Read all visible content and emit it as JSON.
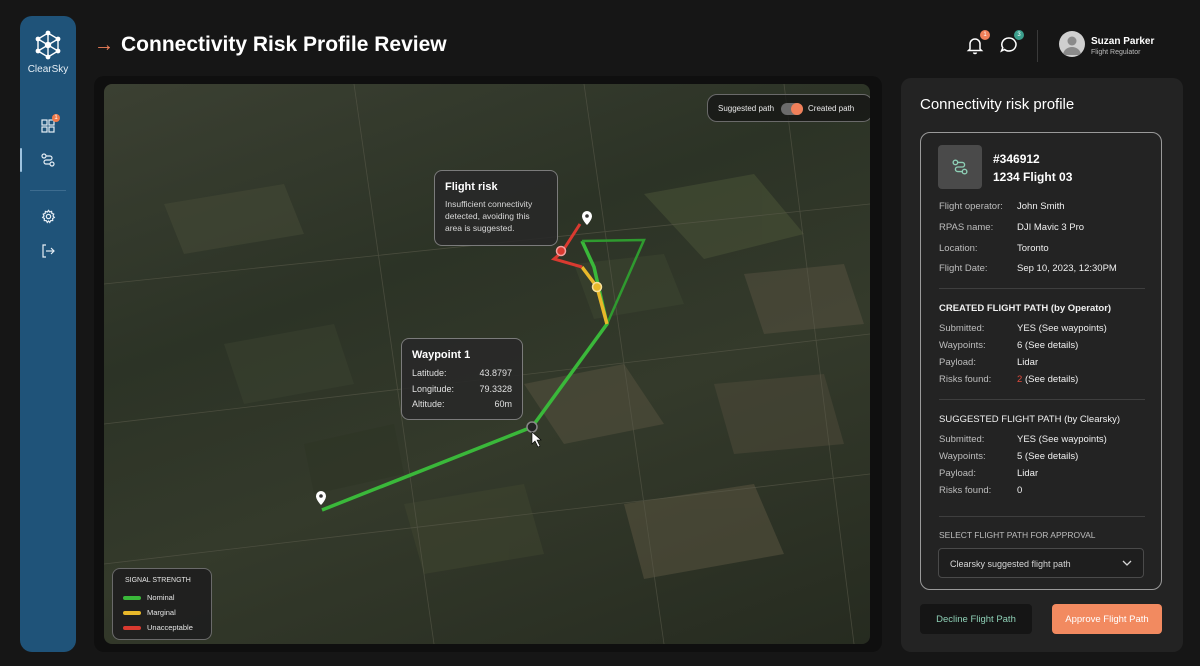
{
  "app": {
    "name": "ClearSky"
  },
  "header": {
    "title": "Connectivity Risk Profile Review",
    "notifications_badge": "1",
    "messages_badge": "3",
    "user": {
      "name": "Suzan Parker",
      "role": "Flight Regulator"
    }
  },
  "sidebar": {
    "items": [
      {
        "icon": "dashboard-icon",
        "badge": "1"
      },
      {
        "icon": "route-icon",
        "active": true
      },
      {
        "icon": "gear-icon"
      },
      {
        "icon": "logout-icon"
      }
    ]
  },
  "map": {
    "toggle": {
      "left_label": "Suggested path",
      "right_label": "Created path",
      "selected": "Created path"
    },
    "flight_risk": {
      "title": "Flight risk",
      "text_lines": [
        "Insufficient connectivity",
        "detected, avoiding this",
        "area is suggested."
      ]
    },
    "waypoint": {
      "title": "Waypoint 1",
      "rows": [
        {
          "label": "Latitude:",
          "value": "43.8797"
        },
        {
          "label": "Longitude:",
          "value": "79.3328"
        },
        {
          "label": "Altitude:",
          "value": "60m"
        }
      ]
    },
    "legend": {
      "title": "SIGNAL STRENGTH",
      "items": [
        {
          "label": "Nominal",
          "color": "#3ab83a"
        },
        {
          "label": "Marginal",
          "color": "#e8b82a"
        },
        {
          "label": "Unacceptable",
          "color": "#d93a30"
        }
      ]
    }
  },
  "panel": {
    "title": "Connectivity risk profile",
    "flight_id": "#346912",
    "flight_name": "1234 Flight 03",
    "details": [
      {
        "label": "Flight operator:",
        "value": "John Smith"
      },
      {
        "label": "RPAS name:",
        "value": "DJI Mavic 3 Pro"
      },
      {
        "label": "Location:",
        "value": "Toronto"
      },
      {
        "label": "Flight Date:",
        "value": "Sep 10, 2023, 12:30PM"
      }
    ],
    "created": {
      "heading": "CREATED FLIGHT PATH (by Operator)",
      "submitted_label": "Submitted:",
      "submitted": "YES (See waypoints)",
      "waypoints_label": "Waypoints:",
      "waypoints": "6 (See details)",
      "payload_label": "Payload:",
      "payload": "Lidar",
      "risks_label": "Risks found:",
      "risks_num": "2",
      "risks_link": "(See details)"
    },
    "suggested": {
      "heading": "SUGGESTED FLIGHT PATH (by Clearsky)",
      "submitted_label": "Submitted:",
      "submitted": "YES (See waypoints)",
      "waypoints_label": "Waypoints:",
      "waypoints": "5 (See details)",
      "payload_label": "Payload:",
      "payload": "Lidar",
      "risks_label": "Risks found:",
      "risks_num": "0"
    },
    "select_label": "SELECT FLIGHT PATH FOR APPROVAL",
    "select_value": "Clearsky suggested flight path",
    "decline_label": "Decline Flight Path",
    "approve_label": "Approve Flight Path"
  },
  "colors": {
    "accent": "#f28a60",
    "sidebar": "#1f5379",
    "nominal": "#3ab83a",
    "marginal": "#e8b82a",
    "unacceptable": "#d93a30"
  }
}
